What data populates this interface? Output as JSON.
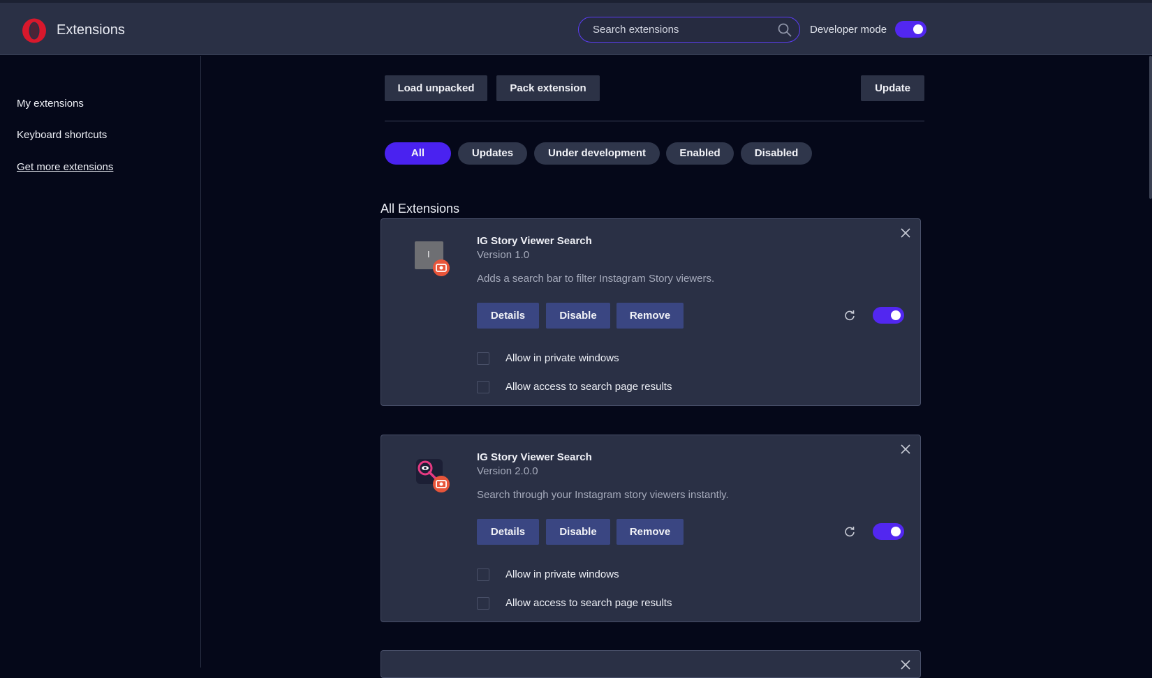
{
  "header": {
    "title": "Extensions",
    "search_placeholder": "Search extensions",
    "developer_mode_label": "Developer mode",
    "developer_mode_on": true,
    "logo": "opera-logo"
  },
  "sidebar": {
    "items": [
      {
        "label": "My extensions"
      },
      {
        "label": "Keyboard shortcuts"
      },
      {
        "label": "Get more extensions"
      }
    ]
  },
  "toolbar": {
    "load_unpacked": "Load unpacked",
    "pack_extension": "Pack extension",
    "update": "Update"
  },
  "filters": [
    "All",
    "Updates",
    "Under development",
    "Enabled",
    "Disabled"
  ],
  "active_filter": "All",
  "section_title": "All Extensions",
  "extensions": [
    {
      "name": "IG Story Viewer Search",
      "version": "Version 1.0",
      "description": "Adds a search bar to filter Instagram Story viewers.",
      "icon_letter": "I",
      "details_label": "Details",
      "disable_label": "Disable",
      "remove_label": "Remove",
      "enabled": true,
      "allow_private_label": "Allow in private windows",
      "allow_search_label": "Allow access to search page results"
    },
    {
      "name": "IG Story Viewer Search",
      "version": "Version 2.0.0",
      "description": "Search through your Instagram story viewers instantly.",
      "details_label": "Details",
      "disable_label": "Disable",
      "remove_label": "Remove",
      "enabled": true,
      "allow_private_label": "Allow in private windows",
      "allow_search_label": "Allow access to search page results"
    }
  ],
  "colors": {
    "accent": "#4a22f0",
    "header_bg": "#2a3045",
    "page_bg": "#050819",
    "badge": "#e8553a"
  }
}
